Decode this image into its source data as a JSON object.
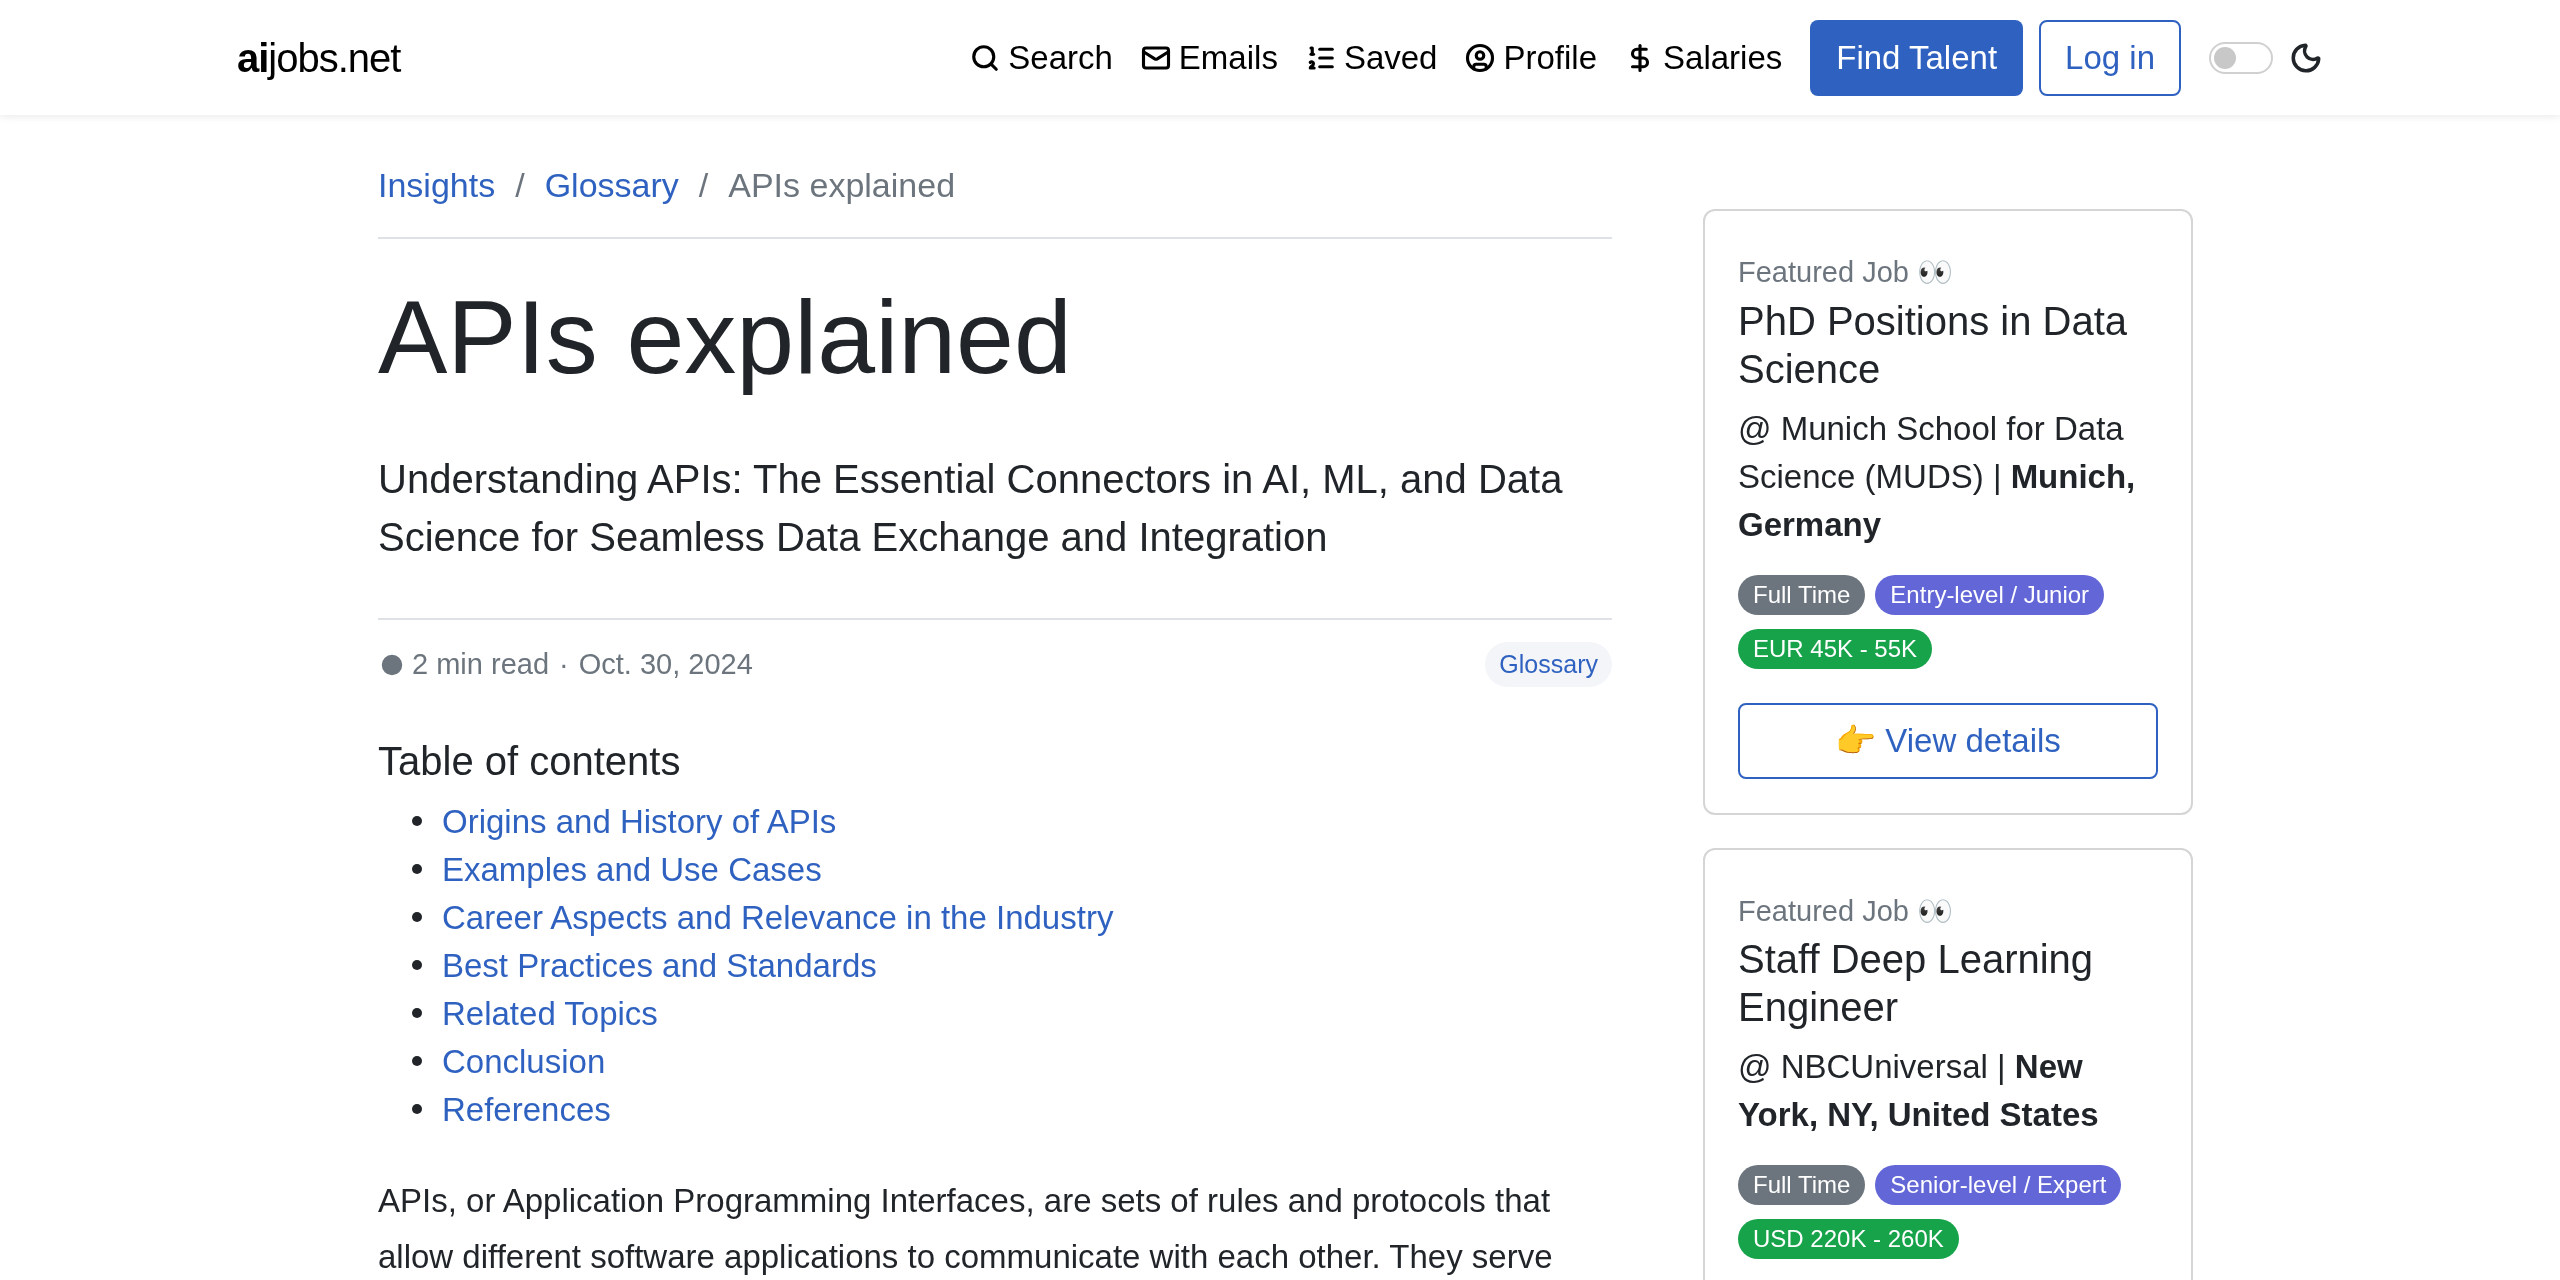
{
  "header": {
    "logo": {
      "bold": "ai",
      "rest": "jobs.net"
    },
    "nav": [
      {
        "label": "Search"
      },
      {
        "label": "Emails"
      },
      {
        "label": "Saved"
      },
      {
        "label": "Profile"
      },
      {
        "label": "Salaries"
      }
    ],
    "primary_button": "Find Talent",
    "login_button": "Log in",
    "dark_mode": {
      "on": false
    }
  },
  "breadcrumbs": [
    {
      "label": "Insights",
      "link": true
    },
    {
      "label": "Glossary",
      "link": true
    },
    {
      "label": "APIs explained",
      "link": false
    }
  ],
  "breadcrumb_separator": "/",
  "article": {
    "title": "APIs explained",
    "subtitle": "Understanding APIs: The Essential Connectors in AI, ML, and Data Science for Seamless Data Exchange and Integration",
    "read_time": "2 min read",
    "dot": "·",
    "date": "Oct. 30, 2024",
    "category": "Glossary",
    "toc_heading": "Table of contents",
    "toc": [
      "Origins and History of APIs",
      "Examples and Use Cases",
      "Career Aspects and Relevance in the Industry",
      "Best Practices and Standards",
      "Related Topics",
      "Conclusion",
      "References"
    ],
    "paragraph_lines": [
      "APIs, or Application Programming Interfaces, are sets of rules and protocols that",
      "allow different software applications to communicate with each other. They serve"
    ]
  },
  "featured_jobs": [
    {
      "label": "Featured Job 👀",
      "title": "PhD Positions in Data Science",
      "company": "@ Munich School for Data Science (MUDS) | **Munich, Germany**",
      "badges": [
        {
          "text": "Full Time",
          "color": "#6c757d"
        },
        {
          "text": "Entry-level / Junior",
          "color": "#6366d6"
        },
        {
          "text": "EUR 45K - 55K",
          "color": "#16a34a"
        }
      ],
      "button": "👉 View details"
    },
    {
      "label": "Featured Job 👀",
      "title": "Staff Deep Learning Engineer",
      "company": "@ NBCUniversal | **New York, NY, United States**",
      "badges": [
        {
          "text": "Full Time",
          "color": "#6c757d"
        },
        {
          "text": "Senior-level / Expert",
          "color": "#6366d6"
        },
        {
          "text": "USD 220K - 260K",
          "color": "#16a34a"
        }
      ]
    }
  ]
}
